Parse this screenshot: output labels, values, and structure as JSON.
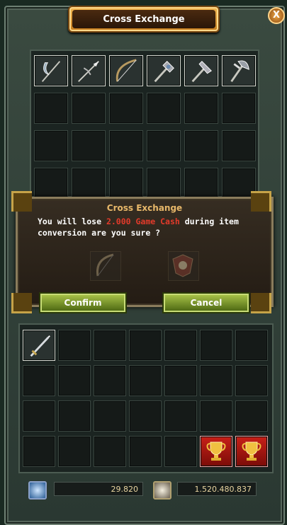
{
  "window": {
    "title": "Cross Exchange",
    "close_label": "X"
  },
  "upper_grid": {
    "icons": [
      "scythe-icon",
      "spear-icon",
      "bow-icon",
      "mace-icon",
      "warhammer-icon",
      "axe-icon"
    ]
  },
  "dialog": {
    "title": "Cross Exchange",
    "msg_prefix": "You will lose ",
    "msg_amount": "2.000 Game Cash",
    "msg_suffix": " during item conversion are you sure ?",
    "confirm_label": "Confirm",
    "cancel_label": "Cancel"
  },
  "currency": {
    "left_value": "29.820",
    "right_value": "1.520.480.837"
  },
  "colors": {
    "highlight": "#e23a2a",
    "button": "#7d9a2c",
    "title_plate": "#d8902c"
  }
}
